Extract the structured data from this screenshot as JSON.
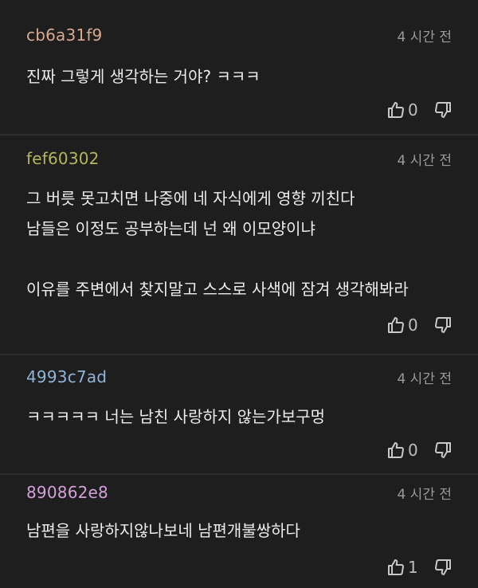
{
  "comments": [
    {
      "author": "cb6a31f9",
      "author_color": "#d8a98f",
      "time": "4 시간 전",
      "body": "진짜 그렇게 생각하는 거야? ㅋㅋㅋ",
      "likes": "0"
    },
    {
      "author": "fef60302",
      "author_color": "#b5b55a",
      "time": "4 시간 전",
      "body": "그 버릇 못고치면 나중에 네 자식에게 영향 끼친다\n남들은 이정도 공부하는데 넌 왜 이모양이냐\n\n이유를 주변에서 찾지말고 스스로 사색에 잠겨 생각해봐라",
      "likes": "0"
    },
    {
      "author": "4993c7ad",
      "author_color": "#8fb4d8",
      "time": "4 시간 전",
      "body": "ㅋㅋㅋㅋㅋ 너는 남친 사랑하지 않는가보구멍",
      "likes": "0"
    },
    {
      "author": "890862e8",
      "author_color": "#d4a0d8",
      "time": "4 시간 전",
      "body": "남편을 사랑하지않나보네 남편개불쌍하다",
      "likes": "1"
    }
  ]
}
